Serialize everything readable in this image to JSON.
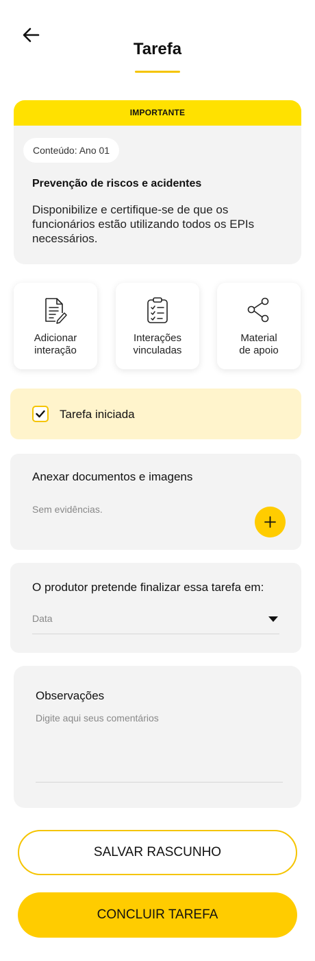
{
  "header": {
    "title": "Tarefa",
    "back_icon": "arrow-left-icon",
    "accent_color": "#F5C400"
  },
  "task": {
    "banner": "IMPORTANTE",
    "banner_color": "#FFE100",
    "content_chip": "Conteúdo: Ano 01",
    "subject": "Prevenção de riscos e acidentes",
    "description": "Disponibilize e certifique-se de que os funcionários estão utilizando todos os EPIs necessários."
  },
  "actions": [
    {
      "line1": "Adicionar",
      "line2": "interação",
      "icon": "document-edit-icon"
    },
    {
      "line1": "Interações",
      "line2": "vinculadas",
      "icon": "clipboard-checklist-icon"
    },
    {
      "line1": "Material",
      "line2": "de apoio",
      "icon": "share-icon"
    }
  ],
  "status": {
    "label": "Tarefa iniciada",
    "checked": true
  },
  "attachments": {
    "title": "Anexar documentos e imagens",
    "empty_text": "Sem evidências.",
    "add_icon": "plus-icon"
  },
  "finish_date": {
    "question": "O produtor pretende finalizar essa tarefa em:",
    "placeholder": "Data"
  },
  "observations": {
    "title": "Observações",
    "placeholder": "Digite aqui seus comentários"
  },
  "buttons": {
    "draft": "SALVAR RASCUNHO",
    "finish": "CONCLUIR TAREFA"
  }
}
